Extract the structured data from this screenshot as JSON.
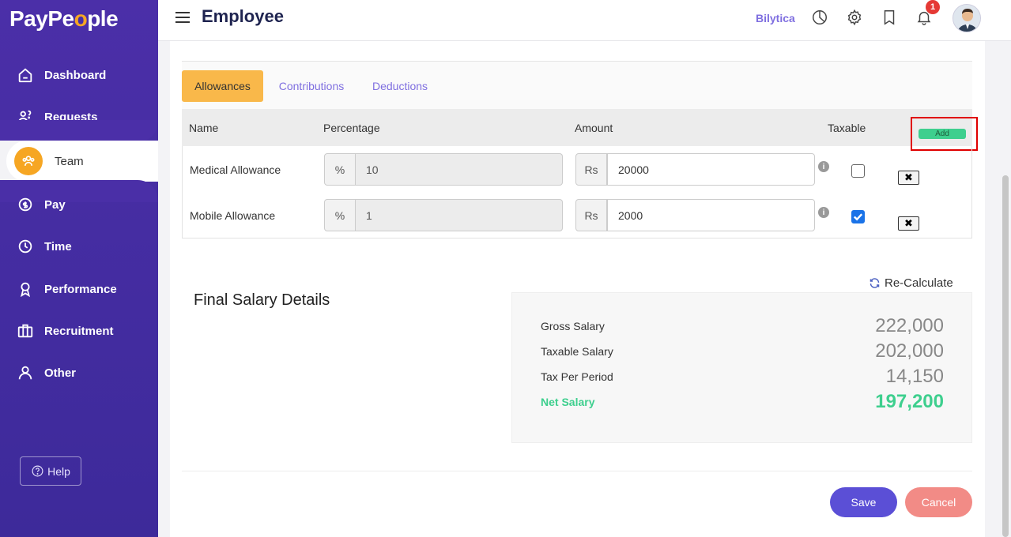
{
  "app": {
    "logo_prefix": "PayPe",
    "logo_o": "o",
    "logo_suffix": "ple"
  },
  "sidebar": {
    "items": [
      {
        "label": "Dashboard",
        "icon": "home-icon"
      },
      {
        "label": "Requests",
        "icon": "requests-icon"
      },
      {
        "label": "Team",
        "icon": "team-icon",
        "active": true
      },
      {
        "label": "Pay",
        "icon": "pay-icon"
      },
      {
        "label": "Time",
        "icon": "clock-icon"
      },
      {
        "label": "Performance",
        "icon": "award-icon"
      },
      {
        "label": "Recruitment",
        "icon": "briefcase-icon"
      },
      {
        "label": "Other",
        "icon": "user-icon"
      }
    ],
    "help_label": "Help"
  },
  "header": {
    "title": "Employee",
    "brand": "Bilytica",
    "notification_count": "1"
  },
  "tabs": [
    {
      "label": "Allowances",
      "active": true
    },
    {
      "label": "Contributions"
    },
    {
      "label": "Deductions"
    }
  ],
  "table": {
    "columns": {
      "name": "Name",
      "percentage": "Percentage",
      "amount": "Amount",
      "taxable": "Taxable"
    },
    "add_label": "Add",
    "percent_symbol": "%",
    "currency_symbol": "Rs",
    "rows": [
      {
        "name": "Medical Allowance",
        "percentage": "10",
        "amount": "20000",
        "taxable": false
      },
      {
        "name": "Mobile Allowance",
        "percentage": "1",
        "amount": "2000",
        "taxable": true
      }
    ]
  },
  "final": {
    "title": "Final Salary Details",
    "recalc_label": "Re-Calculate",
    "gross_label": "Gross Salary",
    "gross_value": "222,000",
    "taxable_label": "Taxable Salary",
    "taxable_value": "202,000",
    "tax_label": "Tax Per Period",
    "tax_value": "14,150",
    "net_label": "Net Salary",
    "net_value": "197,200"
  },
  "actions": {
    "save": "Save",
    "cancel": "Cancel"
  },
  "colors": {
    "sidebar": "#4b2fa8",
    "accent": "#f9b84a",
    "primary": "#5b4fd6",
    "success": "#3ecf8e",
    "danger": "#f28b86"
  }
}
